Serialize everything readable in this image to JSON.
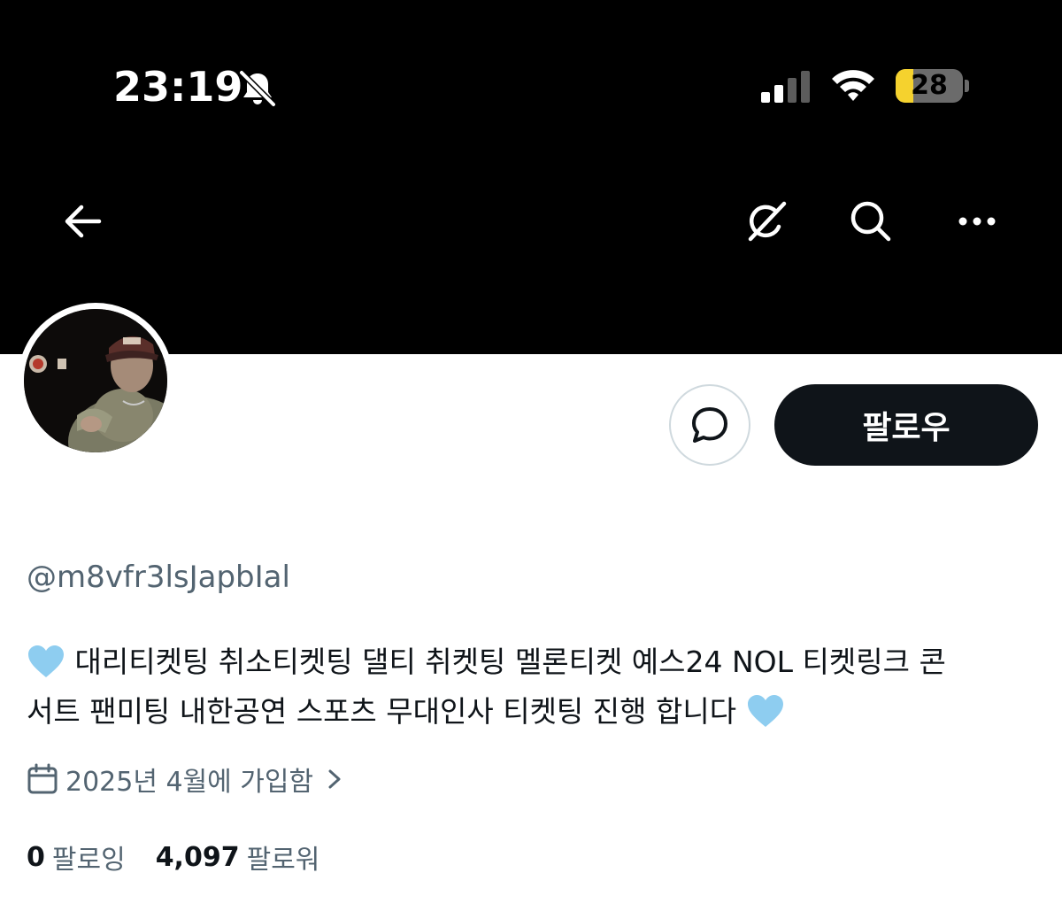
{
  "status_bar": {
    "time": "23:19",
    "battery": "28",
    "icons": [
      "bell-off-icon",
      "signal-icon",
      "wifi-icon",
      "battery-icon"
    ]
  },
  "nav": {
    "icons": [
      "back-arrow-icon",
      "grok-icon",
      "search-icon",
      "more-icon"
    ]
  },
  "profile": {
    "handle": "@m8vfr3lsJapbIal",
    "bio_line1": "대리티켓팅 취소티켓팅 댈티 취켓팅 멜론티켓 예스24 NOL 티켓링크 콘",
    "bio_line2": "서트 팬미팅 내한공연 스포츠 무대인사 티켓팅 진행 합니다",
    "joined": "2025년 4월에 가입함",
    "following_count": "0",
    "following_label": "팔로잉",
    "followers_count": "4,097",
    "followers_label": "팔로워"
  },
  "actions": {
    "follow_label": "팔로우"
  },
  "colors": {
    "header_bg": "#000000",
    "follow_bg": "#0f1419",
    "secondary_text": "#536471",
    "heart": "#8ecdf0",
    "battery_fill": "#f5d22e"
  }
}
